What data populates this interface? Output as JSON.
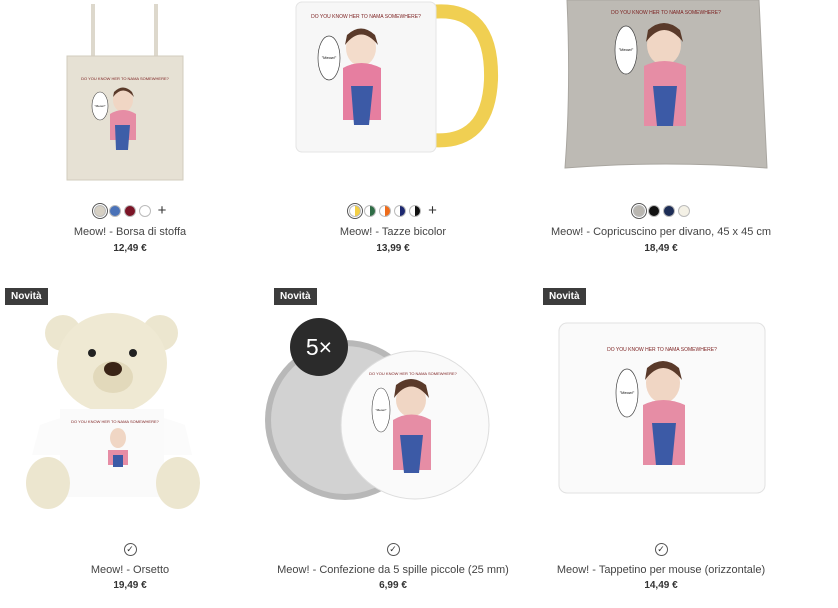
{
  "products": [
    {
      "name": "Meow! - Borsa di stoffa",
      "price": "12,49 €",
      "colors": [
        "#d6d0c4",
        "#4a72b8",
        "#7b1426",
        "#ffffff"
      ],
      "more": "+"
    },
    {
      "name": "Meow! - Tazze bicolor",
      "price": "13,99 €",
      "colors": [
        "#f3cf45",
        "#2f6d46",
        "#ef6c1a",
        "#1d2870",
        "#111111"
      ],
      "more": "+"
    },
    {
      "name": "Meow! - Copricuscino per divano, 45 x 45 cm",
      "price": "18,49 €",
      "colors": [
        "#b9b6b0",
        "#111111",
        "#1d2d56",
        "#f4f1e6"
      ]
    },
    {
      "name": "Meow! - Orsetto",
      "price": "19,49 €",
      "badge": "Novità"
    },
    {
      "name": "Meow! - Confezione da 5 spille piccole (25 mm)",
      "price": "6,99 €",
      "badge": "Novità",
      "quantity_badge": "5×"
    },
    {
      "name": "Meow! - Tappetino per mouse (orizzontale)",
      "price": "14,49 €",
      "badge": "Novità"
    }
  ],
  "design": {
    "caption": "DO YOU KNOW HER TO NAMA SOMEWHERE?",
    "speech": "\"Meow!\""
  },
  "icons": {
    "check": "✓",
    "checkmark-icon": "check-icon"
  }
}
